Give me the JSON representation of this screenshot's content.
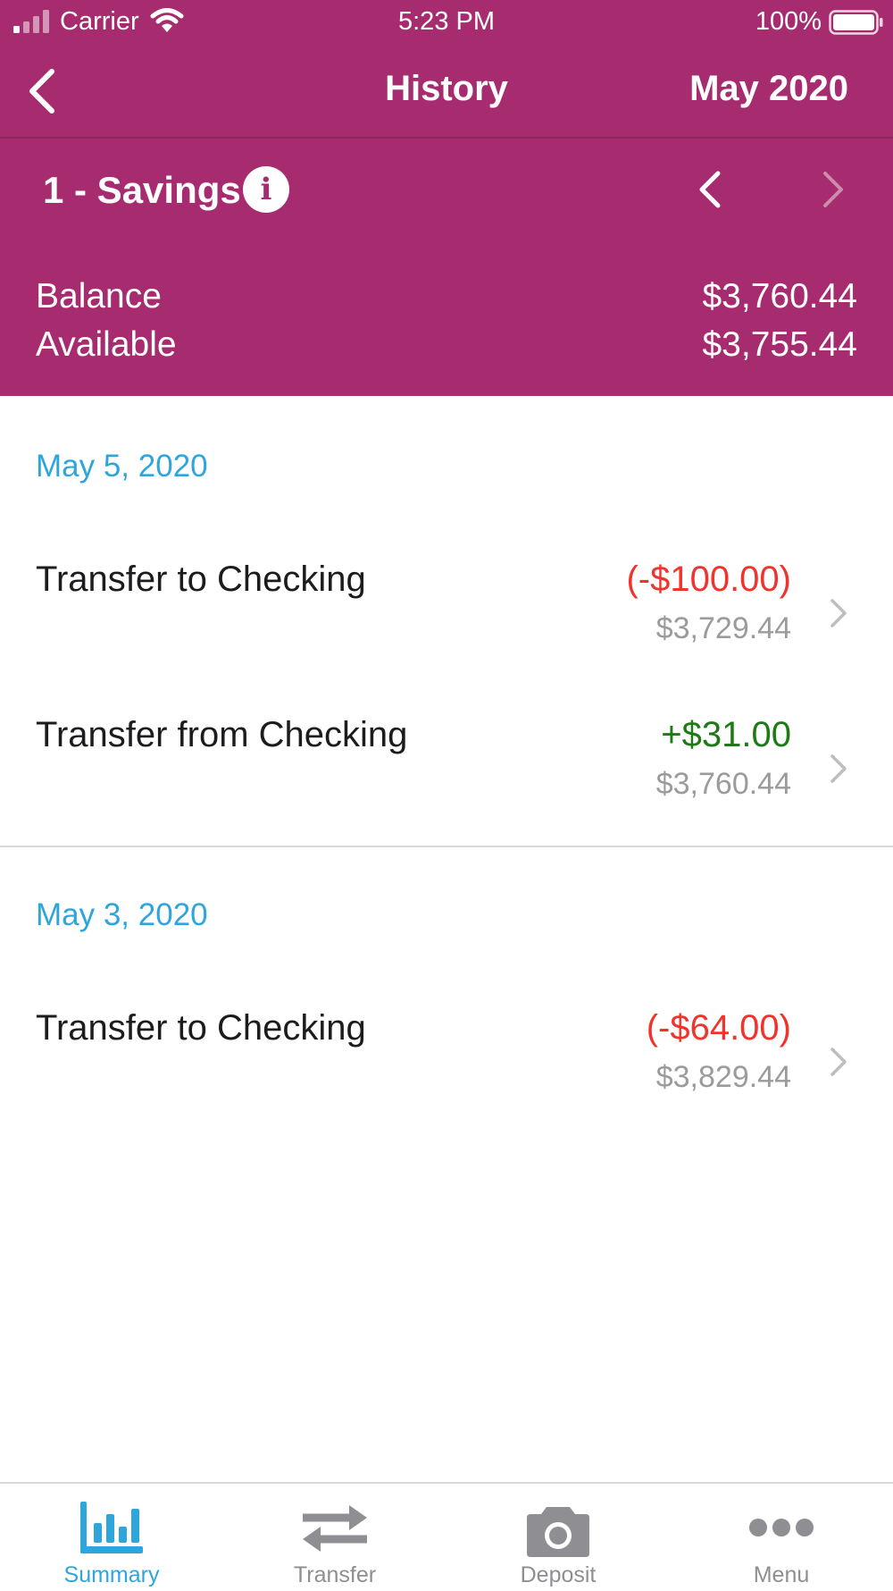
{
  "status_bar": {
    "carrier": "Carrier",
    "time": "5:23 PM",
    "battery": "100%"
  },
  "nav": {
    "title": "History",
    "month": "May 2020"
  },
  "account": {
    "name": "1 - Savings",
    "info_glyph": "i",
    "balance_label": "Balance",
    "balance_value": "$3,760.44",
    "available_label": "Available",
    "available_value": "$3,755.44"
  },
  "groups": [
    {
      "date": "May 5, 2020",
      "transactions": [
        {
          "description": "Transfer to Checking",
          "amount": "(-$100.00)",
          "running_balance": "$3,729.44"
        },
        {
          "description": "Transfer from Checking",
          "amount": "+$31.00",
          "running_balance": "$3,760.44"
        }
      ]
    },
    {
      "date": "May 3, 2020",
      "transactions": [
        {
          "description": "Transfer to Checking",
          "amount": "(-$64.00)",
          "running_balance": "$3,829.44"
        }
      ]
    }
  ],
  "tabs": [
    {
      "label": "Summary",
      "icon": "bar-chart-icon",
      "active": true
    },
    {
      "label": "Transfer",
      "icon": "transfer-arrows-icon",
      "active": false
    },
    {
      "label": "Deposit",
      "icon": "camera-icon",
      "active": false
    },
    {
      "label": "Menu",
      "icon": "more-dots-icon",
      "active": false
    }
  ],
  "colors": {
    "brand": "#a72c6f",
    "accent": "#2ea6dc",
    "negative": "#f0342d",
    "positive": "#1d7a16",
    "muted": "#9b9b9b"
  }
}
